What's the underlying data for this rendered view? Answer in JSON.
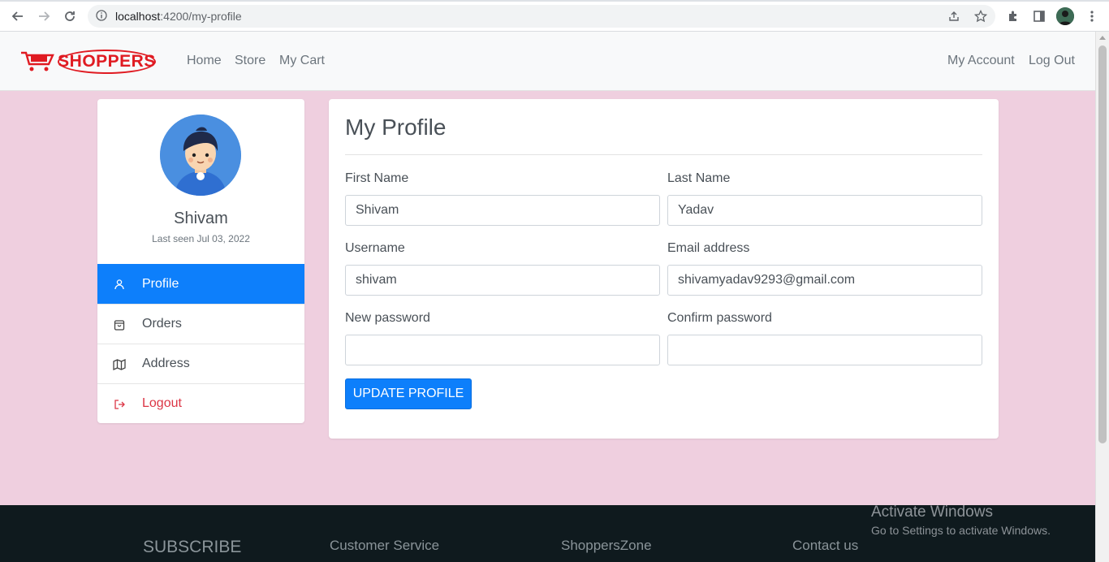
{
  "browser": {
    "url_host": "localhost",
    "url_path": ":4200/my-profile"
  },
  "navbar": {
    "logo_text": "SHOPPERS",
    "links": [
      "Home",
      "Store",
      "My Cart"
    ],
    "right_links": [
      "My Account",
      "Log Out"
    ]
  },
  "sidebar": {
    "name": "Shivam",
    "last_seen": "Last seen Jul 03, 2022",
    "items": [
      {
        "label": "Profile",
        "icon": "user-icon",
        "active": true
      },
      {
        "label": "Orders",
        "icon": "bag-icon"
      },
      {
        "label": "Address",
        "icon": "map-icon"
      },
      {
        "label": "Logout",
        "icon": "logout-icon"
      }
    ]
  },
  "form": {
    "title": "My Profile",
    "first_name_label": "First Name",
    "first_name_value": "Shivam",
    "last_name_label": "Last Name",
    "last_name_value": "Yadav",
    "username_label": "Username",
    "username_value": "shivam",
    "email_label": "Email address",
    "email_value": "shivamyadav9293@gmail.com",
    "new_password_label": "New password",
    "new_password_value": "",
    "confirm_password_label": "Confirm password",
    "confirm_password_value": "",
    "submit_label": "UPDATE PROFILE"
  },
  "footer": {
    "headings": [
      "SUBSCRIBE",
      "Customer Service",
      "ShoppersZone",
      "Contact us"
    ]
  },
  "watermark": {
    "line1": "Activate Windows",
    "line2": "Go to Settings to activate Windows."
  },
  "colors": {
    "page_bg": "#efcfdf",
    "accent": "#0d7ffb",
    "brand_red": "#e01b22",
    "logout_red": "#dc3545",
    "footer_bg": "#0f1a1e"
  }
}
